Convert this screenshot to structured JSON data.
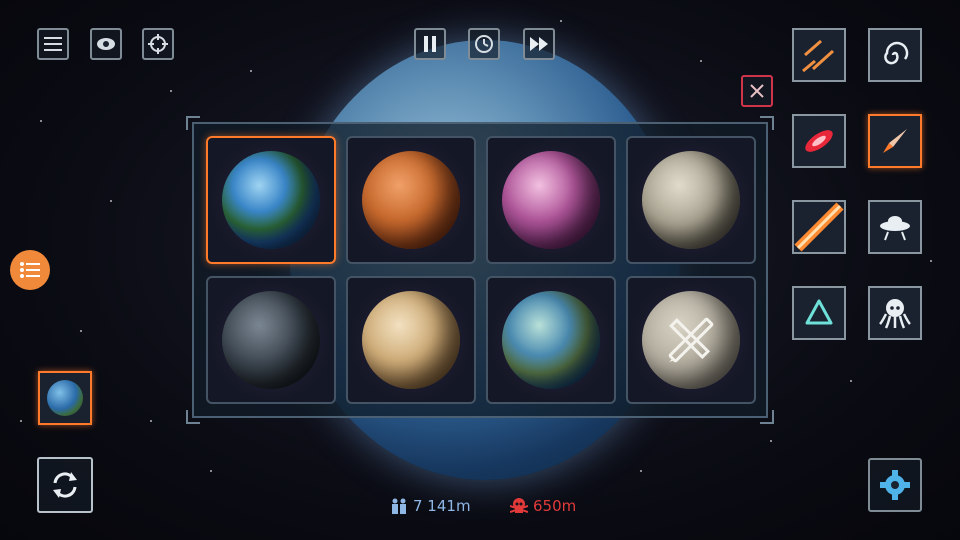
{
  "hud": {
    "population_value": "7 141m",
    "casualties_value": "650m",
    "population_color": "#8fb7e6",
    "casualties_color": "#e23a3a"
  },
  "top_left": {
    "icons": [
      "menu-icon",
      "eye-icon",
      "crosshair-icon"
    ]
  },
  "top_center": {
    "icons": [
      "pause-icon",
      "clock-icon",
      "fast-forward-icon"
    ]
  },
  "planet_picker": {
    "planets": [
      {
        "name": "earth",
        "selected": true
      },
      {
        "name": "mars",
        "selected": false
      },
      {
        "name": "pink-exoplanet",
        "selected": false
      },
      {
        "name": "moon",
        "selected": false
      },
      {
        "name": "death-star",
        "selected": false
      },
      {
        "name": "venus",
        "selected": false
      },
      {
        "name": "ocean-exoplanet",
        "selected": false
      },
      {
        "name": "custom-planet-editor",
        "selected": false
      }
    ]
  },
  "weapons": {
    "tools": [
      "missiles",
      "black-hole",
      "red-laser",
      "rocket",
      "orange-beam",
      "ufo",
      "shield",
      "alien-octopus"
    ],
    "selected": "rocket"
  },
  "colors": {
    "accent": "#ff7a2a",
    "frame": "#7f8c96",
    "close": "#d0344a"
  }
}
